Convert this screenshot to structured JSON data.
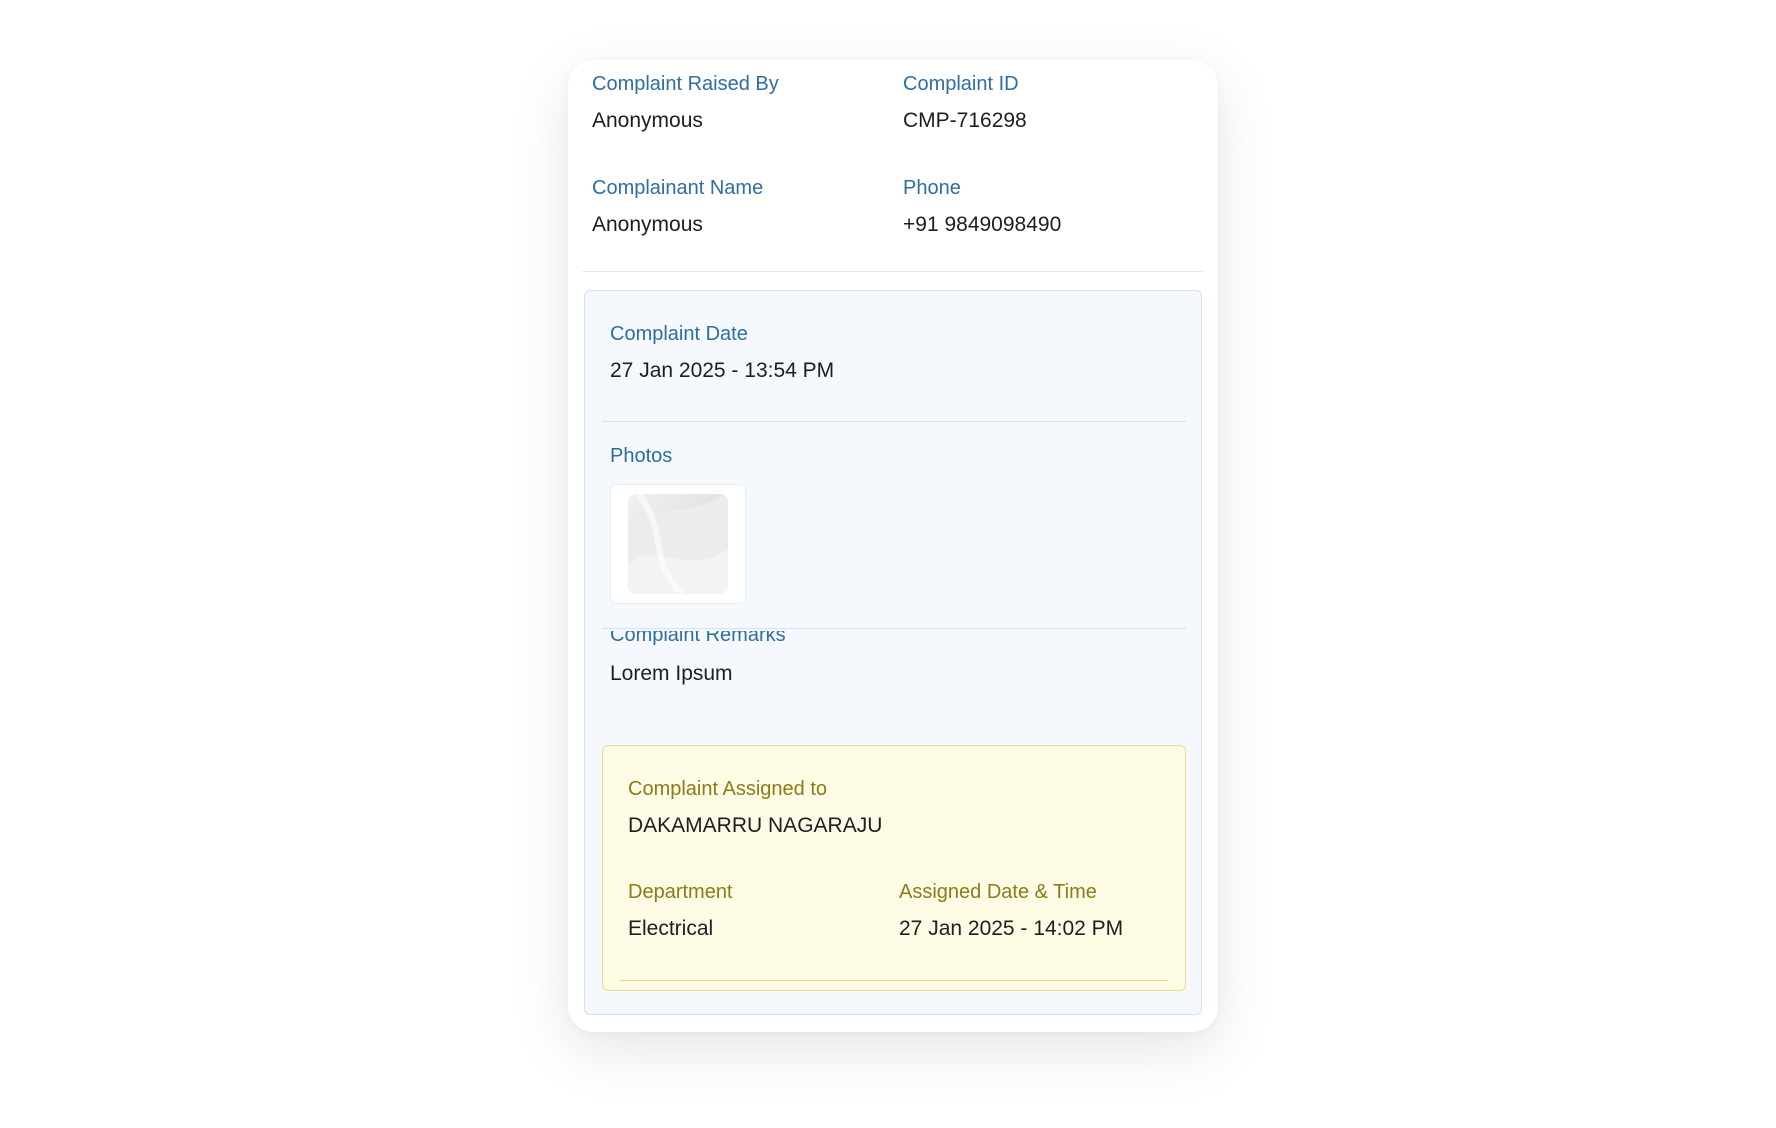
{
  "header": {
    "raised_by_label": "Complaint Raised By",
    "raised_by_value": "Anonymous",
    "complaint_id_label": "Complaint ID",
    "complaint_id_value": "CMP-716298",
    "complainant_name_label": "Complainant Name",
    "complainant_name_value": "Anonymous",
    "phone_label": "Phone",
    "phone_value": "+91 9849098490"
  },
  "details": {
    "date_label": "Complaint Date",
    "date_value": "27 Jan 2025 - 13:54 PM",
    "photos_label": "Photos",
    "remarks_label": "Complaint Remarks",
    "remarks_value": "Lorem Ipsum"
  },
  "assignment": {
    "assigned_to_label": "Complaint Assigned to",
    "assigned_to_value": "DAKAMARRU NAGARAJU",
    "department_label": "Department",
    "department_value": "Electrical",
    "assigned_datetime_label": "Assigned Date & Time",
    "assigned_datetime_value": "27 Jan 2025 - 14:02 PM"
  },
  "colors": {
    "label_blue": "#2d6ea0",
    "label_olive": "#8a7c1a",
    "panel_blue_bg": "#f5f9fd",
    "panel_yellow_bg": "#fefbe4"
  },
  "icons": {
    "photo_thumbnail": "image-placeholder-icon"
  }
}
